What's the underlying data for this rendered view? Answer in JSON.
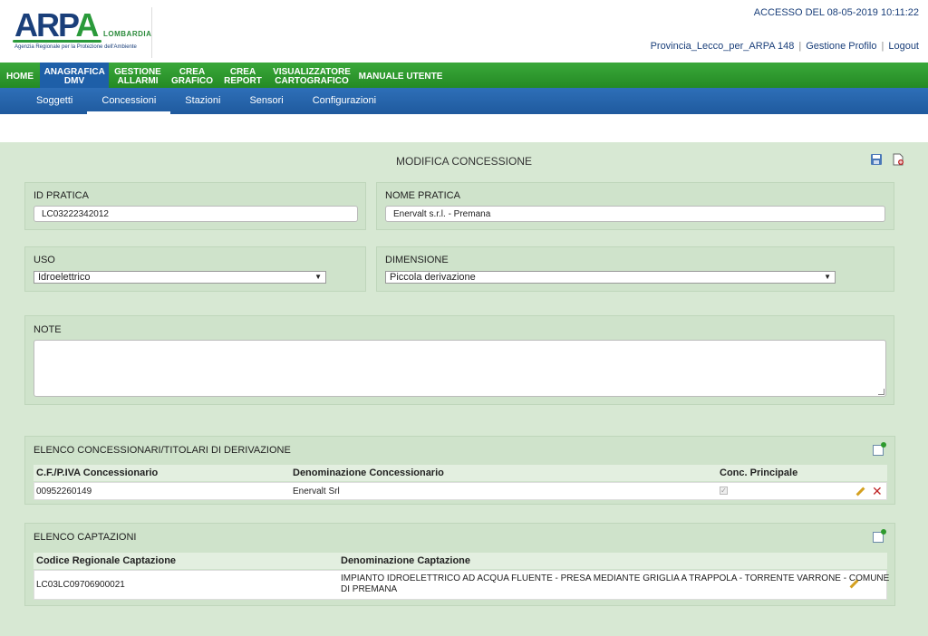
{
  "header": {
    "logo_text": "ARPA",
    "logo_region": "LOMBARDIA",
    "logo_tagline": "Agenzia Regionale per la Protezione dell'Ambiente",
    "access_label": "ACCESSO DEL 08-05-2019 10:11:22",
    "user_link": "Provincia_Lecco_per_ARPA 148",
    "profile_link": "Gestione Profilo",
    "logout_link": "Logout"
  },
  "main_nav": [
    {
      "label": "HOME",
      "active": false
    },
    {
      "label": "ANAGRAFICA DMV",
      "active": true
    },
    {
      "label": "GESTIONE ALLARMI",
      "active": false
    },
    {
      "label": "CREA GRAFICO",
      "active": false
    },
    {
      "label": "CREA REPORT",
      "active": false
    },
    {
      "label": "VISUALIZZATORE CARTOGRAFICO",
      "active": false
    },
    {
      "label": "MANUALE UTENTE",
      "active": false
    }
  ],
  "sub_nav": [
    {
      "label": "Soggetti",
      "active": false
    },
    {
      "label": "Concessioni",
      "active": true
    },
    {
      "label": "Stazioni",
      "active": false
    },
    {
      "label": "Sensori",
      "active": false
    },
    {
      "label": "Configurazioni",
      "active": false
    }
  ],
  "page": {
    "title": "MODIFICA CONCESSIONE",
    "save_icon": "save-icon",
    "export_icon": "pdf-icon"
  },
  "form": {
    "id_pratica_label": "ID PRATICA",
    "id_pratica_value": "LC03222342012",
    "nome_pratica_label": "NOME PRATICA",
    "nome_pratica_value": "Enervalt s.r.l. - Premana",
    "uso_label": "USO",
    "uso_value": "Idroelettrico",
    "dimensione_label": "DIMENSIONE",
    "dimensione_value": "Piccola derivazione",
    "note_label": "NOTE",
    "note_value": ""
  },
  "concessionari": {
    "title": "ELENCO CONCESSIONARI/TITOLARI DI DERIVAZIONE",
    "col_cf": "C.F./P.IVA Concessionario",
    "col_den": "Denominazione Concessionario",
    "col_princ": "Conc. Principale",
    "rows": [
      {
        "cf": "00952260149",
        "den": "Enervalt Srl",
        "principale": true
      }
    ]
  },
  "captazioni": {
    "title": "ELENCO CAPTAZIONI",
    "col_cod": "Codice Regionale Captazione",
    "col_den": "Denominazione Captazione",
    "rows": [
      {
        "cod": "LC03LC09706900021",
        "den_line1": "IMPIANTO IDROELETTRICO AD ACQUA FLUENTE - PRESA MEDIANTE GRIGLIA A TRAPPOLA - TORRENTE VARRONE - COMUNE",
        "den_line2": "DI PREMANA"
      }
    ]
  },
  "colors": {
    "main_nav_green": "#2a9a2a",
    "active_blue": "#1e5fa8",
    "content_bg": "#d7e8d3"
  }
}
